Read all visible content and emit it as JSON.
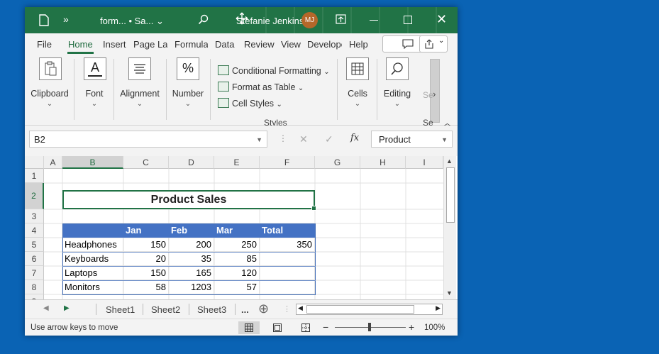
{
  "titlebar": {
    "more": "»",
    "title": "form... • Sa...",
    "title_chevron": "⌄",
    "user": "Stefanie Jenkins",
    "avatar": "MJ",
    "close": "✕"
  },
  "menu": {
    "tabs": [
      "File",
      "Home",
      "Insert",
      "Page Layout",
      "Formulas",
      "Data",
      "Review",
      "View",
      "Developer",
      "Help"
    ],
    "active": "Home"
  },
  "ribbon": {
    "clipboard": "Clipboard",
    "font": "Font",
    "alignment": "Alignment",
    "number": "Number",
    "number_glyph": "%",
    "font_glyph": "A",
    "conditional_formatting": "Conditional Formatting",
    "format_as_table": "Format as Table",
    "cell_styles": "Cell Styles",
    "styles_group": "Styles",
    "cells": "Cells",
    "editing": "Editing",
    "sensitivity": "Se",
    "more_arrow": "›",
    "chevron": "⌄"
  },
  "formula_bar": {
    "name_box": "B2",
    "cancel": "✕",
    "enter": "✓",
    "fx": "fx",
    "value": "Product"
  },
  "grid": {
    "columns": [
      "A",
      "B",
      "C",
      "D",
      "E",
      "F",
      "G",
      "H",
      "I"
    ],
    "rows": [
      "1",
      "2",
      "3",
      "4",
      "5",
      "6",
      "7",
      "8",
      "9"
    ],
    "title": "Product Sales",
    "table_headers": [
      "",
      "Jan",
      "Feb",
      "Mar",
      "Total"
    ],
    "table_rows": [
      {
        "product": "Headphones",
        "jan": "150",
        "feb": "200",
        "mar": "250",
        "total": "350"
      },
      {
        "product": "Keyboards",
        "jan": "20",
        "feb": "35",
        "mar": "85",
        "total": ""
      },
      {
        "product": "Laptops",
        "jan": "150",
        "feb": "165",
        "mar": "120",
        "total": ""
      },
      {
        "product": "Monitors",
        "jan": "58",
        "feb": "1203",
        "mar": "57",
        "total": ""
      }
    ]
  },
  "sheets": {
    "tabs": [
      "Sheet1",
      "Sheet2",
      "Sheet3"
    ],
    "overflow": "...",
    "add": "⊕"
  },
  "status": {
    "message": "Use arrow keys to move",
    "zoom": "100%",
    "zoom_minus": "−",
    "zoom_plus": "+"
  }
}
